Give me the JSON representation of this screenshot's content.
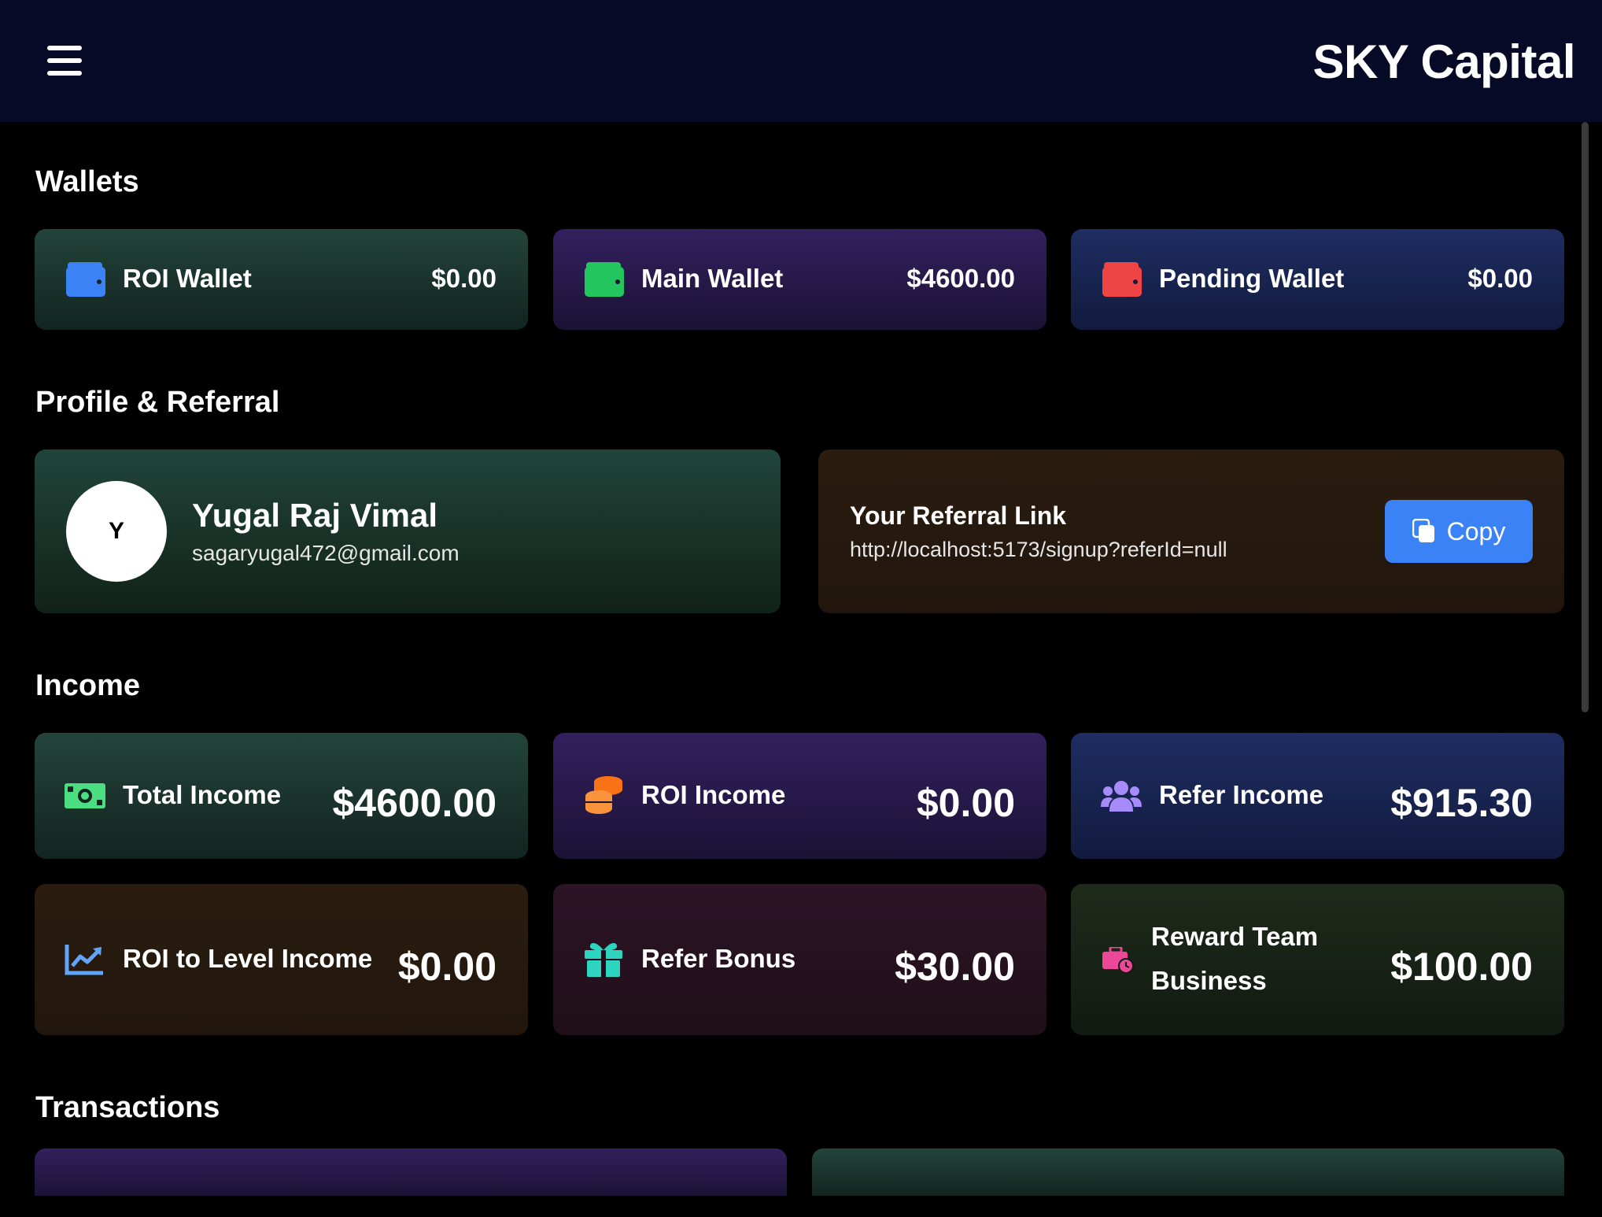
{
  "header": {
    "brand": "SKY Capital",
    "menu_icon": "hamburger-menu-icon"
  },
  "sections": {
    "wallets": "Wallets",
    "profile_referral": "Profile & Referral",
    "income": "Income",
    "transactions": "Transactions"
  },
  "wallets": [
    {
      "label": "ROI Wallet",
      "value": "$0.00",
      "icon": "wallet-icon",
      "color": "#3b82f6"
    },
    {
      "label": "Main Wallet",
      "value": "$4600.00",
      "icon": "wallet-icon",
      "color": "#22c55e"
    },
    {
      "label": "Pending Wallet",
      "value": "$0.00",
      "icon": "wallet-icon",
      "color": "#ef4444"
    }
  ],
  "profile": {
    "initial": "Y",
    "name": "Yugal Raj Vimal",
    "email": "sagaryugal472@gmail.com"
  },
  "referral": {
    "title": "Your Referral Link",
    "link": "http://localhost:5173/signup?referId=null",
    "copy_label": "Copy",
    "copy_icon": "copy-icon"
  },
  "income": [
    {
      "label": "Total Income",
      "value": "$4600.00",
      "icon": "money-bill-icon",
      "color": "#4ade80"
    },
    {
      "label": "ROI Income",
      "value": "$0.00",
      "icon": "coins-icon",
      "color": "#f97316"
    },
    {
      "label": "Refer Income",
      "value": "$915.30",
      "icon": "users-icon",
      "color": "#a78bfa"
    },
    {
      "label": "ROI to Level Income",
      "value": "$0.00",
      "icon": "chart-line-icon",
      "color": "#60a5fa"
    },
    {
      "label": "Refer Bonus",
      "value": "$30.00",
      "icon": "gift-icon",
      "color": "#2dd4bf"
    },
    {
      "label_line1": "Reward Team",
      "label_line2": "Business",
      "value": "$100.00",
      "icon": "business-time-icon",
      "color": "#ec4899"
    }
  ],
  "colors": {
    "header_bg": "#060a26",
    "accent": "#3b82f6"
  }
}
